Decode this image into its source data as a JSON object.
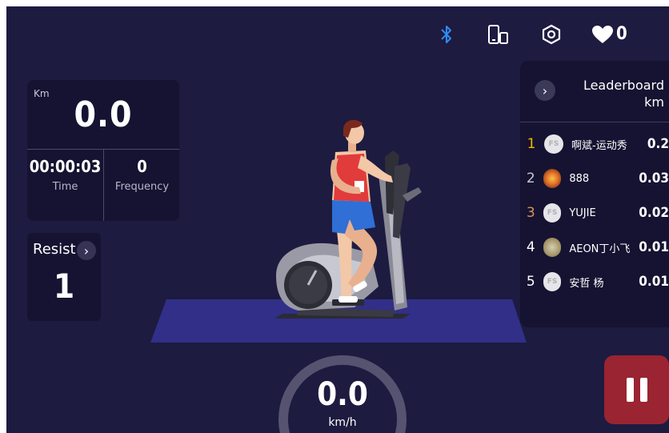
{
  "topbar": {
    "icons": [
      "bluetooth-icon",
      "phone-tablet-icon",
      "settings-icon",
      "heart-icon"
    ],
    "bluetooth_color": "#2f8cf0",
    "heart_count": "0"
  },
  "stats": {
    "distance_unit_label": "Km",
    "distance_value": "0.0",
    "time_value": "00:00:03",
    "time_label": "Time",
    "frequency_value": "0",
    "frequency_label": "Frequency"
  },
  "resist": {
    "label": "Resist",
    "value": "1",
    "chevron_icon": "chevron-right-icon"
  },
  "leaderboard": {
    "title": "Leaderboard",
    "unit": "km",
    "rows": [
      {
        "rank": "1",
        "name": "啊斌-运动秀",
        "distance": "0.2",
        "rank_color": "#f5b400",
        "avatar_text": "FS"
      },
      {
        "rank": "2",
        "name": "888",
        "distance": "0.03",
        "rank_color": "#c9c9d6",
        "avatar_text": ""
      },
      {
        "rank": "3",
        "name": "YUJIE",
        "distance": "0.02",
        "rank_color": "#d9925a",
        "avatar_text": "FS"
      },
      {
        "rank": "4",
        "name": "AEON丁小飞",
        "distance": "0.01",
        "rank_color": "#ffffff",
        "avatar_text": ""
      },
      {
        "rank": "5",
        "name": "安哲 杨",
        "distance": "0.01",
        "rank_color": "#ffffff",
        "avatar_text": "FS"
      }
    ]
  },
  "speed": {
    "value": "0.0",
    "unit": "km/h"
  },
  "colors": {
    "background": "#1d1b40",
    "panel": "#151331",
    "mat": "#312f87",
    "pause": "#9a2432"
  }
}
